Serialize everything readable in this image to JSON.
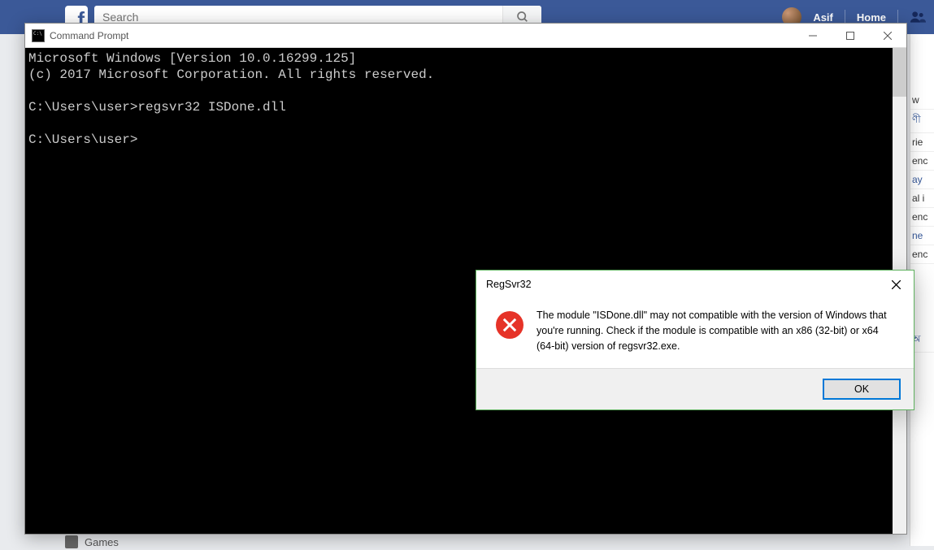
{
  "facebook": {
    "search_placeholder": "Search",
    "username": "Asif",
    "home_label": "Home",
    "side_items": [
      "w",
      "ণী",
      "rie",
      "enc",
      "ay",
      "al i",
      "enc",
      "ne",
      "enc",
      "অ"
    ],
    "bottom_label": "Games"
  },
  "cmd": {
    "window_title": "Command Prompt",
    "lines": {
      "l0": "Microsoft Windows [Version 10.0.16299.125]",
      "l1": "(c) 2017 Microsoft Corporation. All rights reserved.",
      "l2": "",
      "l3": "C:\\Users\\user>regsvr32 ISDone.dll",
      "l4": "",
      "l5": "C:\\Users\\user>"
    }
  },
  "dialog": {
    "title": "RegSvr32",
    "message": "The module \"ISDone.dll\" may not compatible with the version of Windows that you're running. Check if the module is compatible with an x86 (32-bit) or x64 (64-bit) version of regsvr32.exe.",
    "ok_label": "OK"
  }
}
